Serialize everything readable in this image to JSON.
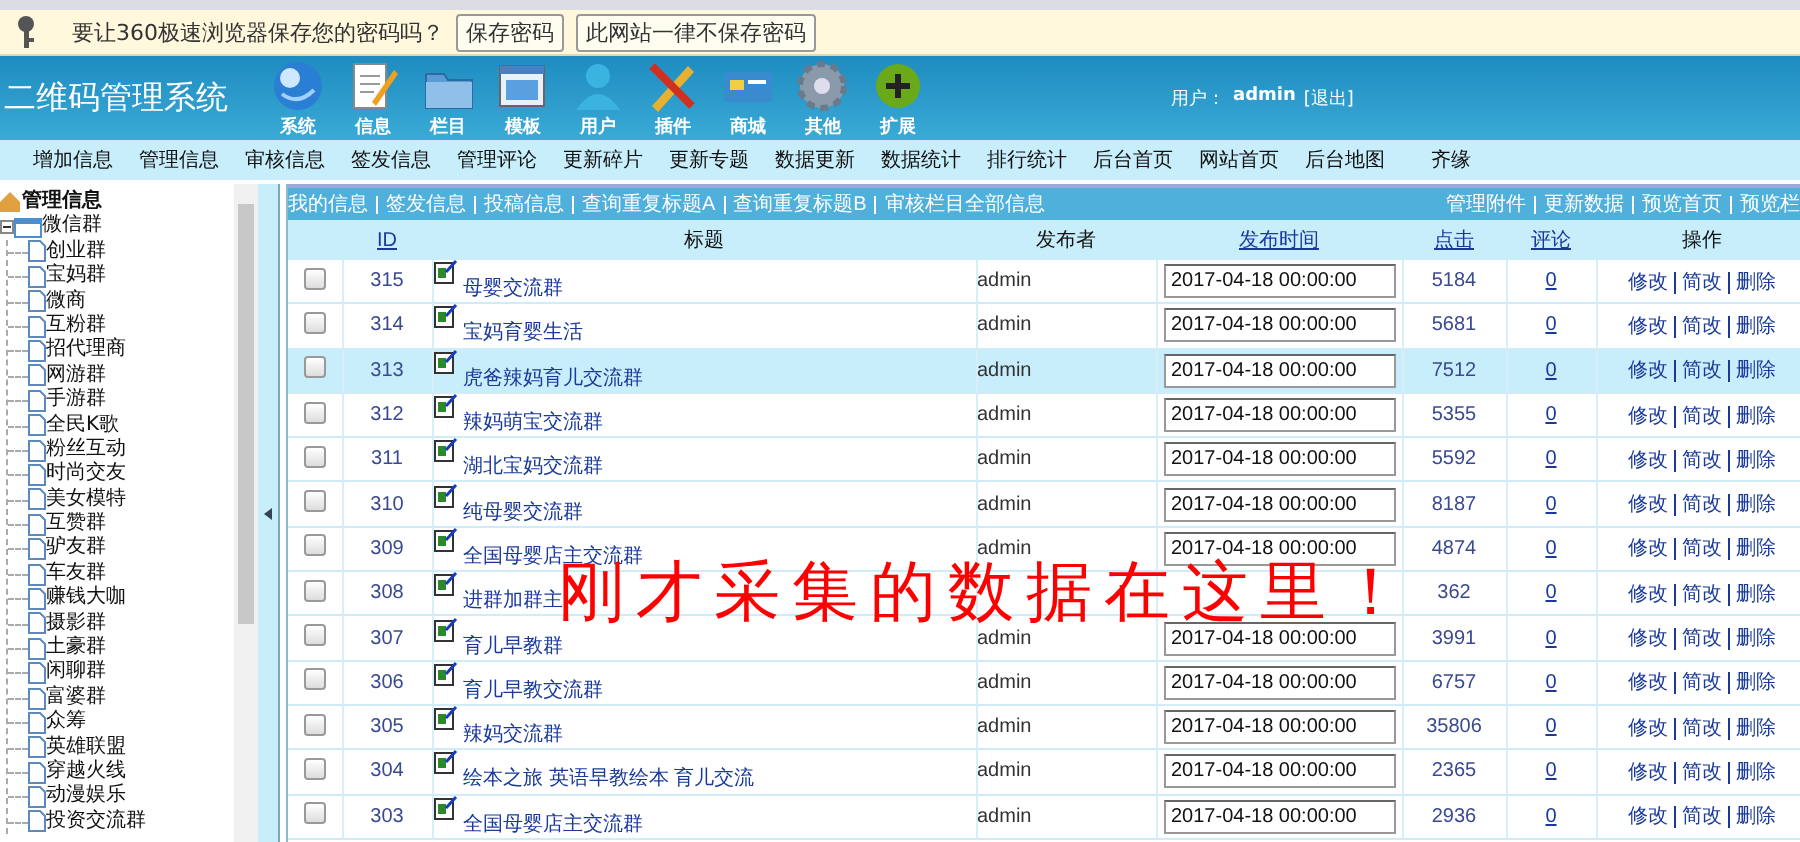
{
  "password_bar": {
    "message": "要让360极速浏览器保存您的密码吗？",
    "buttons": [
      "保存密码",
      "此网站一律不保存密码"
    ]
  },
  "header": {
    "title": "二维码管理系统",
    "modules": [
      {
        "kind": "globe",
        "label": "系统"
      },
      {
        "kind": "document",
        "label": "信息"
      },
      {
        "kind": "folder",
        "label": "栏目"
      },
      {
        "kind": "window",
        "label": "模板"
      },
      {
        "kind": "user",
        "label": "用户"
      },
      {
        "kind": "tools",
        "label": "插件"
      },
      {
        "kind": "card",
        "label": "商城"
      },
      {
        "kind": "gear",
        "label": "其他"
      },
      {
        "kind": "plus",
        "label": "扩展"
      }
    ],
    "user_label": "用户：",
    "user": "admin",
    "logout": "[退出]"
  },
  "nav": [
    "增加信息",
    "管理信息",
    "审核信息",
    "签发信息",
    "管理评论",
    "更新碎片",
    "更新专题",
    "数据更新",
    "数据统计",
    "排行统计",
    "后台首页",
    "网站首页",
    "后台地图",
    "齐缘"
  ],
  "sidebar": {
    "root": "管理信息",
    "items": [
      {
        "label": "微信群",
        "expanded": true,
        "children": [
          {
            "label": "创业群"
          },
          {
            "label": "宝妈群"
          },
          {
            "label": "微商"
          },
          {
            "label": "互粉群"
          },
          {
            "label": "招代理商"
          },
          {
            "label": "网游群"
          },
          {
            "label": "手游群"
          },
          {
            "label": "全民K歌"
          },
          {
            "label": "粉丝互动"
          },
          {
            "label": "时尚交友"
          },
          {
            "label": "美女模特"
          },
          {
            "label": "互赞群"
          },
          {
            "label": "驴友群"
          },
          {
            "label": "车友群"
          },
          {
            "label": "赚钱大咖"
          },
          {
            "label": "摄影群"
          },
          {
            "label": "土豪群"
          },
          {
            "label": "闲聊群"
          },
          {
            "label": "富婆群"
          },
          {
            "label": "众筹"
          },
          {
            "label": "英雄联盟"
          },
          {
            "label": "穿越火线"
          },
          {
            "label": "动漫娱乐"
          },
          {
            "label": "投资交流群"
          }
        ]
      }
    ]
  },
  "toolbar": {
    "left": [
      "我的信息",
      "签发信息",
      "投稿信息",
      "查询重复标题A",
      "查询重复标题B",
      "审核栏目全部信息"
    ],
    "right": [
      "管理附件",
      "更新数据",
      "预览首页",
      "预览栏"
    ]
  },
  "table": {
    "columns": [
      {
        "label": "ID",
        "sortable": true
      },
      {
        "label": "标题",
        "sortable": false
      },
      {
        "label": "发布者",
        "sortable": false
      },
      {
        "label": "发布时间",
        "sortable": true
      },
      {
        "label": "点击",
        "sortable": true
      },
      {
        "label": "评论",
        "sortable": true
      },
      {
        "label": "操作",
        "sortable": false
      }
    ],
    "rows": [
      {
        "checked": false,
        "selected": false,
        "id": "315",
        "title": "母婴交流群",
        "publisher": "admin",
        "time": "2017-04-18 00:00:00",
        "clicks": "5184",
        "comments": "0",
        "actions": [
          "修改",
          "简改",
          "删除"
        ]
      },
      {
        "checked": false,
        "selected": false,
        "id": "314",
        "title": "宝妈育婴生活",
        "publisher": "admin",
        "time": "2017-04-18 00:00:00",
        "clicks": "5681",
        "comments": "0",
        "actions": [
          "修改",
          "简改",
          "删除"
        ]
      },
      {
        "checked": false,
        "selected": true,
        "id": "313",
        "title": "虎爸辣妈育儿交流群",
        "publisher": "admin",
        "time": "2017-04-18 00:00:00",
        "clicks": "7512",
        "comments": "0",
        "actions": [
          "修改",
          "简改",
          "删除"
        ]
      },
      {
        "checked": false,
        "selected": false,
        "id": "312",
        "title": "辣妈萌宝交流群",
        "publisher": "admin",
        "time": "2017-04-18 00:00:00",
        "clicks": "5355",
        "comments": "0",
        "actions": [
          "修改",
          "简改",
          "删除"
        ]
      },
      {
        "checked": false,
        "selected": false,
        "id": "311",
        "title": "湖北宝妈交流群",
        "publisher": "admin",
        "time": "2017-04-18 00:00:00",
        "clicks": "5592",
        "comments": "0",
        "actions": [
          "修改",
          "简改",
          "删除"
        ]
      },
      {
        "checked": false,
        "selected": false,
        "id": "310",
        "title": "纯母婴交流群",
        "publisher": "admin",
        "time": "2017-04-18 00:00:00",
        "clicks": "8187",
        "comments": "0",
        "actions": [
          "修改",
          "简改",
          "删除"
        ]
      },
      {
        "checked": false,
        "selected": false,
        "id": "309",
        "title": "全国母婴店主交流群",
        "publisher": "admin",
        "time": "2017-04-18 00:00:00",
        "clicks": "4874",
        "comments": "0",
        "actions": [
          "修改",
          "简改",
          "删除"
        ]
      },
      {
        "checked": false,
        "selected": false,
        "id": "308",
        "title": "进群加群主",
        "clicks": "362",
        "comments": "0",
        "actions": [
          "修改",
          "简改",
          "删除"
        ]
      },
      {
        "checked": false,
        "selected": false,
        "id": "307",
        "title": "育儿早教群",
        "publisher": "admin",
        "time": "2017-04-18 00:00:00",
        "clicks": "3991",
        "comments": "0",
        "actions": [
          "修改",
          "简改",
          "删除"
        ]
      },
      {
        "checked": false,
        "selected": false,
        "id": "306",
        "title": "育儿早教交流群",
        "publisher": "admin",
        "time": "2017-04-18 00:00:00",
        "clicks": "6757",
        "comments": "0",
        "actions": [
          "修改",
          "简改",
          "删除"
        ]
      },
      {
        "checked": false,
        "selected": false,
        "id": "305",
        "title": "辣妈交流群",
        "publisher": "admin",
        "time": "2017-04-18 00:00:00",
        "clicks": "35806",
        "comments": "0",
        "actions": [
          "修改",
          "简改",
          "删除"
        ]
      },
      {
        "checked": false,
        "selected": false,
        "id": "304",
        "title": "绘本之旅 英语早教绘本 育儿交流",
        "publisher": "admin",
        "time": "2017-04-18 00:00:00",
        "clicks": "2365",
        "comments": "0",
        "actions": [
          "修改",
          "简改",
          "删除"
        ]
      },
      {
        "checked": false,
        "selected": false,
        "id": "303",
        "title": "全国母婴店主交流群",
        "publisher": "admin",
        "time": "2017-04-18 00:00:00",
        "clicks": "2936",
        "comments": "0",
        "actions": [
          "修改",
          "简改",
          "删除"
        ]
      }
    ]
  },
  "annotation": "刚才采集的数据在这里！"
}
